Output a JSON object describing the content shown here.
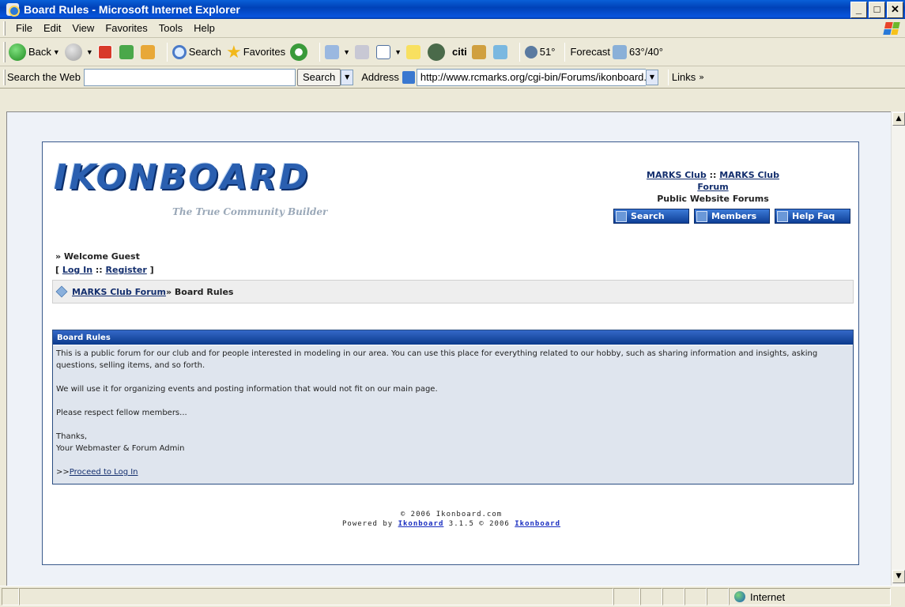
{
  "window": {
    "title": "Board Rules - Microsoft Internet Explorer"
  },
  "menu": {
    "items": [
      "File",
      "Edit",
      "View",
      "Favorites",
      "Tools",
      "Help"
    ]
  },
  "toolbar": {
    "back": "Back",
    "search": "Search",
    "favorites": "Favorites",
    "weather_temp": "51°",
    "forecast": "Forecast",
    "forecast_temp": "63°/40°"
  },
  "addressbar": {
    "search_label": "Search the Web",
    "search_value": "",
    "search_button": "Search",
    "address_label": "Address",
    "url": "http://www.rcmarks.org/cgi-bin/Forums/ikonboard.cgi?act=Reg",
    "links": "Links"
  },
  "page": {
    "logo_text": "IKONBOARD",
    "tagline": "The True Community Builder",
    "club_link": "MARKS Club",
    "sep": " :: ",
    "forum_link": "MARKS Club Forum",
    "forum_subtitle": "Public Website Forums",
    "nav": {
      "search": "Search",
      "members": "Members",
      "help": "Help Faq"
    },
    "welcome": "» Welcome Guest",
    "login": "Log In",
    "register": "Register",
    "breadcrumb_link": "MARKS Club Forum",
    "breadcrumb_current": " » Board Rules",
    "rules": {
      "title": "Board Rules",
      "p1": "This is a public forum for our club and for people interested in modeling in our area. You can use this place for everything related to our hobby, such as sharing information and insights, asking questions, selling items, and so forth.",
      "p2": "We will use it for organizing events and posting information that would not fit on our main page.",
      "p3": "Please respect fellow members...",
      "thanks": "Thanks,",
      "signature": "Your Webmaster & Forum Admin",
      "proceed_prefix": ">>",
      "proceed_link": "Proceed to Log In"
    },
    "footer": {
      "copyright": "© 2006 Ikonboard.com",
      "powered_prefix": "Powered by ",
      "powered_link": "Ikonboard",
      "version": " 3.1.5 © 2006 ",
      "vendor_link": "Ikonboard"
    }
  },
  "status": {
    "zone": "Internet"
  },
  "colors": {
    "titlebar": "#0a5fd8",
    "rules_header": "#0b3a8c",
    "link": "#142f6e"
  }
}
